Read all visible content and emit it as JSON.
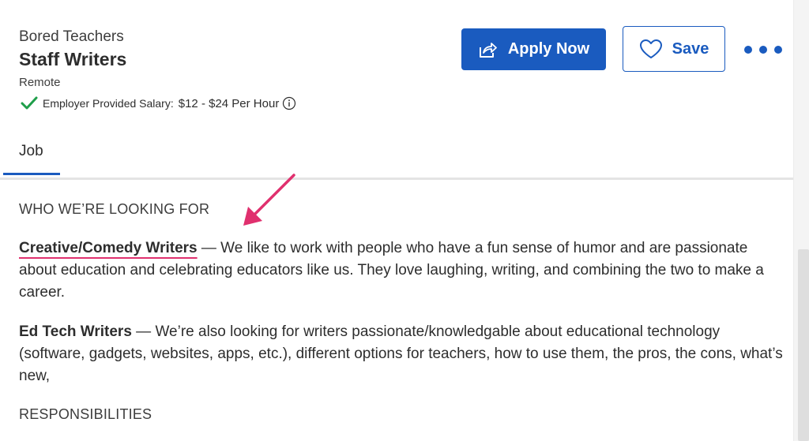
{
  "header": {
    "company": "Bored Teachers",
    "job_title": "Staff Writers",
    "location": "Remote",
    "salary_label": "Employer Provided Salary:",
    "salary_value": "$12 - $24 Per Hour",
    "check_icon": "check-icon",
    "info_icon": "info-icon"
  },
  "actions": {
    "apply_label": "Apply Now",
    "apply_icon": "share-icon",
    "save_label": "Save",
    "save_icon": "heart-icon",
    "more_icon": "more-dots-icon"
  },
  "tabs": [
    {
      "label": "Job",
      "active": true
    }
  ],
  "content": {
    "heading_looking_for": "WHO WE’RE LOOKING FOR",
    "creative_title": "Creative/Comedy Writers",
    "creative_text": " — We like to work with people who have a fun sense of humor and are passionate about education and celebrating educators like us. They love laughing, writing, and combining the two to make a career.",
    "edtech_title": "Ed Tech Writers",
    "edtech_text": " — We’re also looking for writers passionate/knowledgable about educational technology (software, gadgets, websites, apps, etc.), different options for teachers, how to use them, the pros, the cons, what’s new,",
    "heading_responsibilities": "RESPONSIBILITIES"
  },
  "colors": {
    "accent": "#1a5bbf",
    "check": "#1f9e4a",
    "annotation": "#e0306e"
  }
}
